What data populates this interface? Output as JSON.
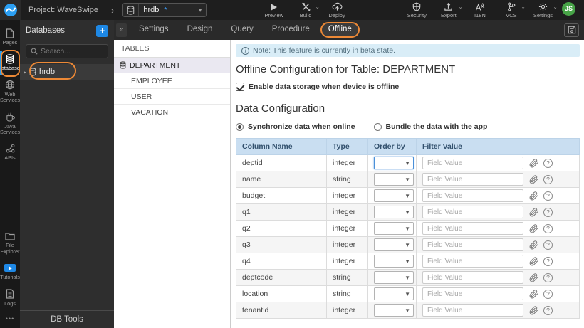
{
  "topbar": {
    "project_label": "Project: WaveSwipe",
    "db_selector": {
      "value": "hrdb",
      "modified_marker": "*"
    },
    "actions_left": [
      {
        "label": "Preview"
      },
      {
        "label": "Build"
      },
      {
        "label": "Deploy"
      }
    ],
    "actions_right": [
      {
        "label": "Security"
      },
      {
        "label": "Export"
      },
      {
        "label": "I18N"
      },
      {
        "label": "VCS"
      },
      {
        "label": "Settings"
      }
    ],
    "avatar_initials": "JS"
  },
  "sidebar": {
    "items": [
      {
        "label": "Pages"
      },
      {
        "label": "Databases",
        "active": true
      },
      {
        "label": "Web Services"
      },
      {
        "label": "Java Services"
      },
      {
        "label": "APIs"
      },
      {
        "label": "File Explorer"
      },
      {
        "label": "Tutorials"
      },
      {
        "label": "Logs"
      }
    ],
    "more": "•••"
  },
  "db_panel": {
    "title": "Databases",
    "add_button": "+",
    "search_placeholder": "Search...",
    "items": [
      {
        "label": "hrdb"
      }
    ],
    "footer": "DB Tools"
  },
  "tabs": {
    "collapse_glyph": "«",
    "items": [
      {
        "label": "Settings"
      },
      {
        "label": "Design"
      },
      {
        "label": "Query"
      },
      {
        "label": "Procedure"
      },
      {
        "label": "Offline",
        "active": true
      }
    ]
  },
  "tables_panel": {
    "title": "TABLES",
    "items": [
      {
        "label": "DEPARTMENT",
        "selected": true
      },
      {
        "label": "EMPLOYEE"
      },
      {
        "label": "USER"
      },
      {
        "label": "VACATION"
      }
    ]
  },
  "offline": {
    "note": "Note: This feature is currently in beta state.",
    "title": "Offline Configuration for Table: DEPARTMENT",
    "enable_label": "Enable data storage when device is offline",
    "enable_checked": true,
    "section_title": "Data Configuration",
    "radios": [
      {
        "label": "Synchronize data when online",
        "selected": true
      },
      {
        "label": "Bundle the data with the app",
        "selected": false
      }
    ],
    "table": {
      "headers": [
        "Column Name",
        "Type",
        "Order by",
        "Filter Value"
      ],
      "filter_placeholder": "Field Value",
      "rows": [
        {
          "name": "deptid",
          "type": "integer"
        },
        {
          "name": "name",
          "type": "string"
        },
        {
          "name": "budget",
          "type": "integer"
        },
        {
          "name": "q1",
          "type": "integer"
        },
        {
          "name": "q2",
          "type": "integer"
        },
        {
          "name": "q3",
          "type": "integer"
        },
        {
          "name": "q4",
          "type": "integer"
        },
        {
          "name": "deptcode",
          "type": "string"
        },
        {
          "name": "location",
          "type": "string"
        },
        {
          "name": "tenantid",
          "type": "integer"
        }
      ]
    }
  },
  "icons": {
    "breadcrumb_chevron": "›",
    "dropdown_caret": "▾",
    "small_caret": "⌄",
    "expand_arrow": "▸",
    "info": "i",
    "help": "?"
  },
  "colors": {
    "accent_blue": "#1e88e5",
    "annotation_orange": "#ed8936",
    "banner_bg": "#d9edf7",
    "table_header_bg": "#c9def1",
    "selected_table_row_bg": "#eae8f1",
    "avatar_green": "#47a347"
  }
}
